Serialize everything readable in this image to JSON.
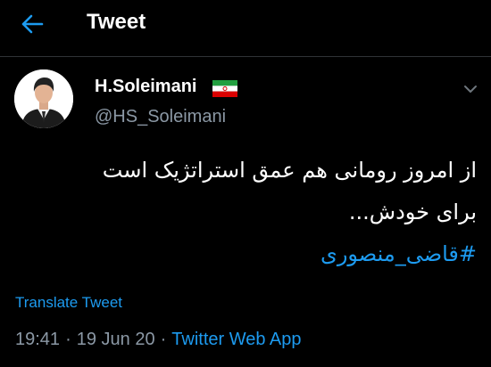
{
  "header": {
    "title": "Tweet",
    "back_icon": "arrow-left-icon"
  },
  "tweet": {
    "author": {
      "display_name": "H.Soleimani",
      "handle": "@HS_Soleimani",
      "badge_icon": "iran-flag-icon"
    },
    "text_lines": [
      "از امروز رومانی هم عمق استراتژیک است",
      "برای خودش..."
    ],
    "hashtag": "#قاضی_منصوری",
    "translate_label": "Translate Tweet",
    "time": "19:41",
    "date": "19 Jun 20",
    "source": "Twitter Web App",
    "separator": "·"
  },
  "colors": {
    "background": "#000000",
    "accent": "#1d9bf0",
    "secondary_text": "#8b98a5",
    "divider": "#2f3336"
  }
}
